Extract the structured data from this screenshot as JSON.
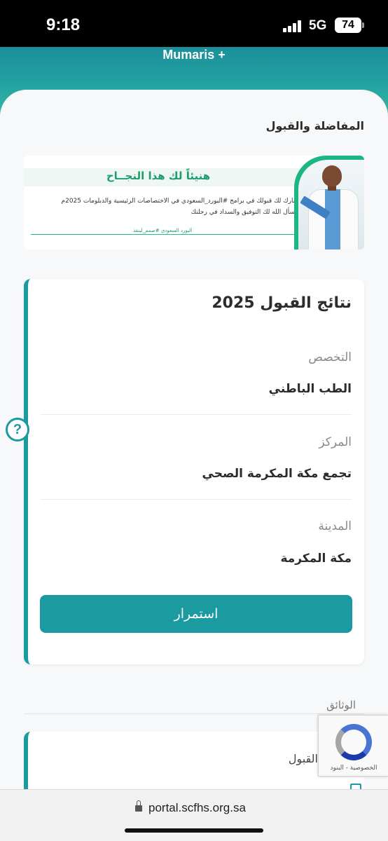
{
  "status_bar": {
    "time": "9:18",
    "network": "5G",
    "battery": "74"
  },
  "header": {
    "brand": "Mumaris +"
  },
  "page": {
    "section_title": "المفاضلة والقبول"
  },
  "banner": {
    "headline": "هنيئاً لك هذا النجــاح",
    "line1": "نبارك لك قبولك في برامج #البورد_السعودي في الاختصاصات الرئيسية والدبلومات 2025م",
    "line2": "نسأل الله لك التوفيق والسداد في رحلتك",
    "hashtag": "البورد السعودي #صمم_لينقذ"
  },
  "result_card": {
    "title": "نتائج القبول 2025",
    "fields": [
      {
        "label": "التخصص",
        "value": "الطب الباطني"
      },
      {
        "label": "المركز",
        "value": "تجمع مكة المكرمة الصحي"
      },
      {
        "label": "المدينة",
        "value": "مكة المكرمة"
      }
    ],
    "continue_label": "استمرار"
  },
  "help": {
    "icon": "help-circle-icon",
    "glyph": "?"
  },
  "documents": {
    "title": "الوثائق",
    "card_label": "القبول"
  },
  "recaptcha": {
    "text": "الخصوصية - البنود"
  },
  "browser": {
    "url": "portal.scfhs.org.sa"
  },
  "colors": {
    "accent": "#1b9aa0",
    "header_start": "#1b8f9b",
    "header_end": "#3fc0a8",
    "banner_green": "#1e9e6c"
  }
}
